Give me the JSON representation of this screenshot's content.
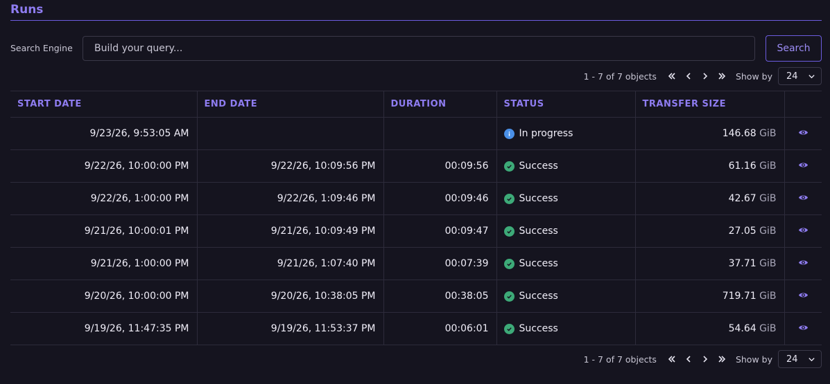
{
  "page": {
    "title": "Runs"
  },
  "search": {
    "label": "Search Engine",
    "placeholder": "Build your query...",
    "value": "",
    "button_label": "Search"
  },
  "pagination": {
    "summary": "1 - 7 of 7 objects",
    "show_by_label": "Show by",
    "page_size": "24"
  },
  "colors": {
    "accent": "#8e7cf0",
    "success": "#3daa78",
    "info": "#4a90e8",
    "background": "#15141f"
  },
  "table": {
    "columns": [
      "START DATE",
      "END DATE",
      "DURATION",
      "STATUS",
      "TRANSFER SIZE"
    ],
    "rows": [
      {
        "start": "9/23/26, 9:53:05 AM",
        "end": "",
        "duration": "",
        "status": "In progress",
        "status_icon": "info-icon",
        "size": "146.68",
        "unit": "GiB"
      },
      {
        "start": "9/22/26, 10:00:00 PM",
        "end": "9/22/26, 10:09:56 PM",
        "duration": "00:09:56",
        "status": "Success",
        "status_icon": "check-circle-icon",
        "size": "61.16",
        "unit": "GiB"
      },
      {
        "start": "9/22/26, 1:00:00 PM",
        "end": "9/22/26, 1:09:46 PM",
        "duration": "00:09:46",
        "status": "Success",
        "status_icon": "check-circle-icon",
        "size": "42.67",
        "unit": "GiB"
      },
      {
        "start": "9/21/26, 10:00:01 PM",
        "end": "9/21/26, 10:09:49 PM",
        "duration": "00:09:47",
        "status": "Success",
        "status_icon": "check-circle-icon",
        "size": "27.05",
        "unit": "GiB"
      },
      {
        "start": "9/21/26, 1:00:00 PM",
        "end": "9/21/26, 1:07:40 PM",
        "duration": "00:07:39",
        "status": "Success",
        "status_icon": "check-circle-icon",
        "size": "37.71",
        "unit": "GiB"
      },
      {
        "start": "9/20/26, 10:00:00 PM",
        "end": "9/20/26, 10:38:05 PM",
        "duration": "00:38:05",
        "status": "Success",
        "status_icon": "check-circle-icon",
        "size": "719.71",
        "unit": "GiB"
      },
      {
        "start": "9/19/26, 11:47:35 PM",
        "end": "9/19/26, 11:53:37 PM",
        "duration": "00:06:01",
        "status": "Success",
        "status_icon": "check-circle-icon",
        "size": "54.64",
        "unit": "GiB"
      }
    ]
  }
}
